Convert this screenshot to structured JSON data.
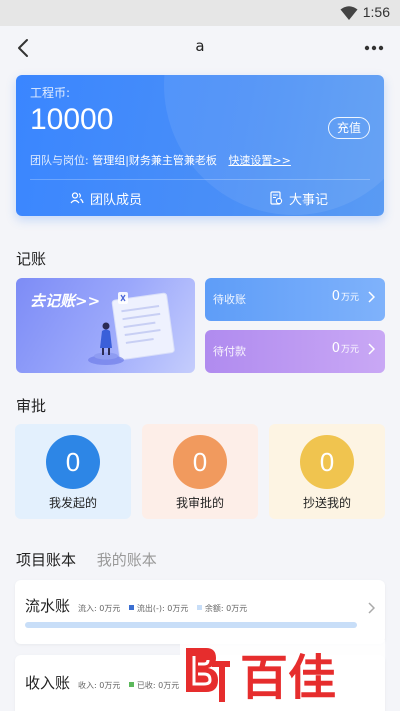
{
  "status_bar": {
    "time": "1:56"
  },
  "nav": {
    "title": "a"
  },
  "hero": {
    "coin_label": "工程币:",
    "coin_value": "10000",
    "recharge_label": "充值",
    "team_label": "团队与岗位:",
    "team_value": "管理组|财务兼主管兼老板",
    "quick_settings": "快速设置>>",
    "members_label": "团队成员",
    "events_label": "大事记"
  },
  "bookkeeping": {
    "title": "记账",
    "go_label": "去记账>>",
    "receivable": {
      "label": "待收账",
      "amount": "0",
      "unit": "万元"
    },
    "payable": {
      "label": "待付款",
      "amount": "0",
      "unit": "万元"
    }
  },
  "approval": {
    "title": "审批",
    "items": [
      {
        "count": "0",
        "label": "我发起的"
      },
      {
        "count": "0",
        "label": "我审批的"
      },
      {
        "count": "0",
        "label": "抄送我的"
      }
    ]
  },
  "ledger_tabs": {
    "active": "项目账本",
    "inactive": "我的账本"
  },
  "ledgers": [
    {
      "name": "流水账",
      "legend": [
        "流入: 0万元",
        "流出(-): 0万元",
        "余额: 0万元"
      ]
    },
    {
      "name": "收入账",
      "legend": [
        "收入: 0万元",
        "已收: 0万元"
      ]
    }
  ],
  "colors": {
    "accent_blue": "#3a86ff",
    "legend_out": "#3b6fd1",
    "legend_balance": "#c8def8",
    "legend_received": "#5cb85c"
  },
  "watermark": {
    "text": "百佳"
  }
}
